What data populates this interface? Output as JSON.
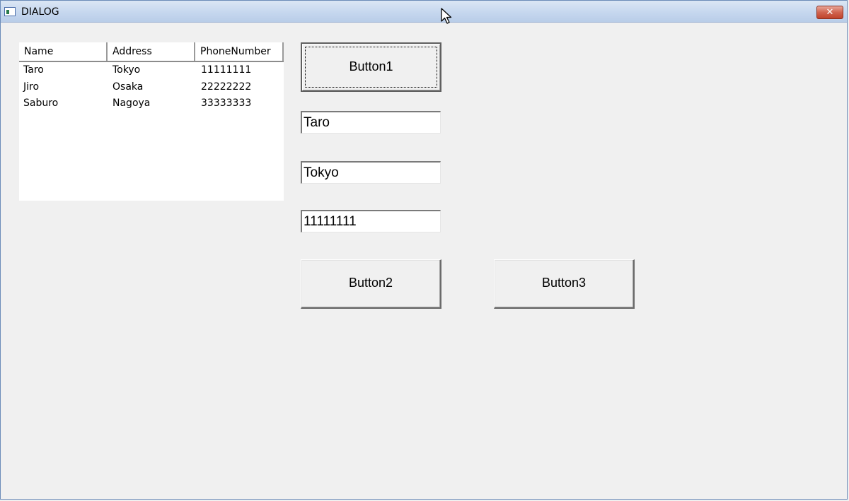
{
  "window": {
    "title": "DIALOG",
    "close_label": "✕"
  },
  "listview": {
    "columns": [
      "Name",
      "Address",
      "PhoneNumber"
    ],
    "rows": [
      [
        "Taro",
        "Tokyo",
        "11111111"
      ],
      [
        "Jiro",
        "Osaka",
        "22222222"
      ],
      [
        "Saburo",
        "Nagoya",
        "33333333"
      ]
    ]
  },
  "buttons": {
    "button1": "Button1",
    "button2": "Button2",
    "button3": "Button3"
  },
  "fields": {
    "name_value": "Taro",
    "address_value": "Tokyo",
    "phone_value": "11111111"
  },
  "icons": {
    "app": "app-window-icon",
    "close": "close-icon",
    "cursor": "mouse-cursor-icon"
  }
}
